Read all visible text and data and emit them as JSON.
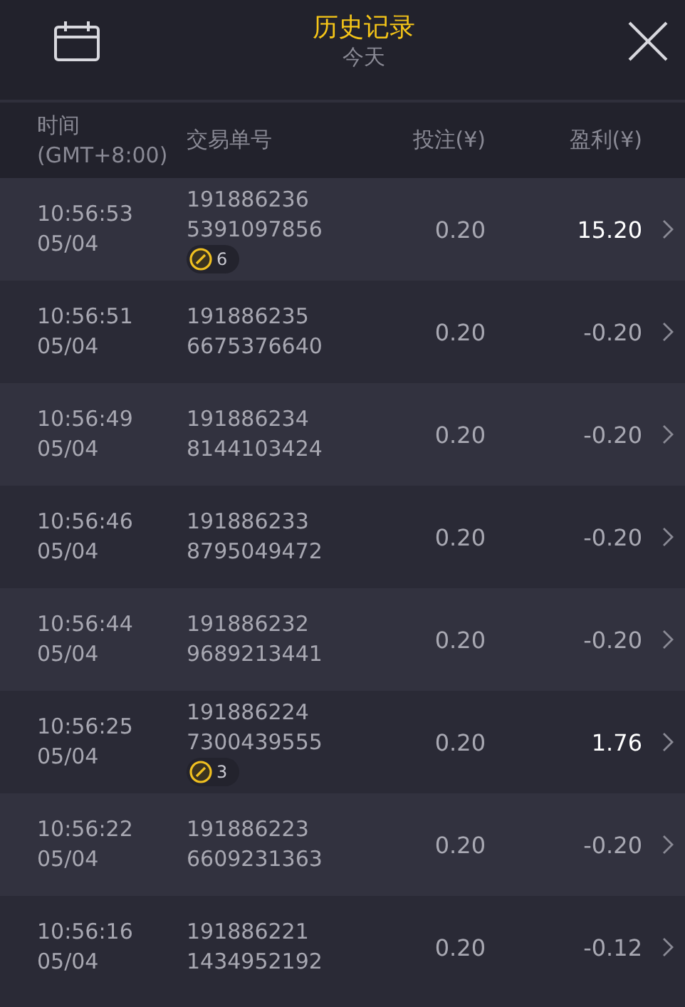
{
  "header": {
    "title": "历史记录",
    "subtitle": "今天"
  },
  "columns": [
    "时间\n(GMT+8:00)",
    "交易单号",
    "投注(¥)",
    "盈利(¥)"
  ],
  "rows": [
    {
      "time": "10:56:53",
      "date": "05/04",
      "id1": "191886236",
      "id2": "5391097856",
      "badge": "6",
      "bet": "0.20",
      "profit": "15.20",
      "win": true
    },
    {
      "time": "10:56:51",
      "date": "05/04",
      "id1": "191886235",
      "id2": "6675376640",
      "bet": "0.20",
      "profit": "-0.20",
      "win": false
    },
    {
      "time": "10:56:49",
      "date": "05/04",
      "id1": "191886234",
      "id2": "8144103424",
      "bet": "0.20",
      "profit": "-0.20",
      "win": false
    },
    {
      "time": "10:56:46",
      "date": "05/04",
      "id1": "191886233",
      "id2": "8795049472",
      "bet": "0.20",
      "profit": "-0.20",
      "win": false
    },
    {
      "time": "10:56:44",
      "date": "05/04",
      "id1": "191886232",
      "id2": "9689213441",
      "bet": "0.20",
      "profit": "-0.20",
      "win": false
    },
    {
      "time": "10:56:25",
      "date": "05/04",
      "id1": "191886224",
      "id2": "7300439555",
      "badge": "3",
      "bet": "0.20",
      "profit": "1.76",
      "win": true
    },
    {
      "time": "10:56:22",
      "date": "05/04",
      "id1": "191886223",
      "id2": "6609231363",
      "bet": "0.20",
      "profit": "-0.20",
      "win": false
    },
    {
      "time": "10:56:16",
      "date": "05/04",
      "id1": "191886221",
      "id2": "1434952192",
      "bet": "0.20",
      "profit": "-0.12",
      "win": false
    }
  ]
}
